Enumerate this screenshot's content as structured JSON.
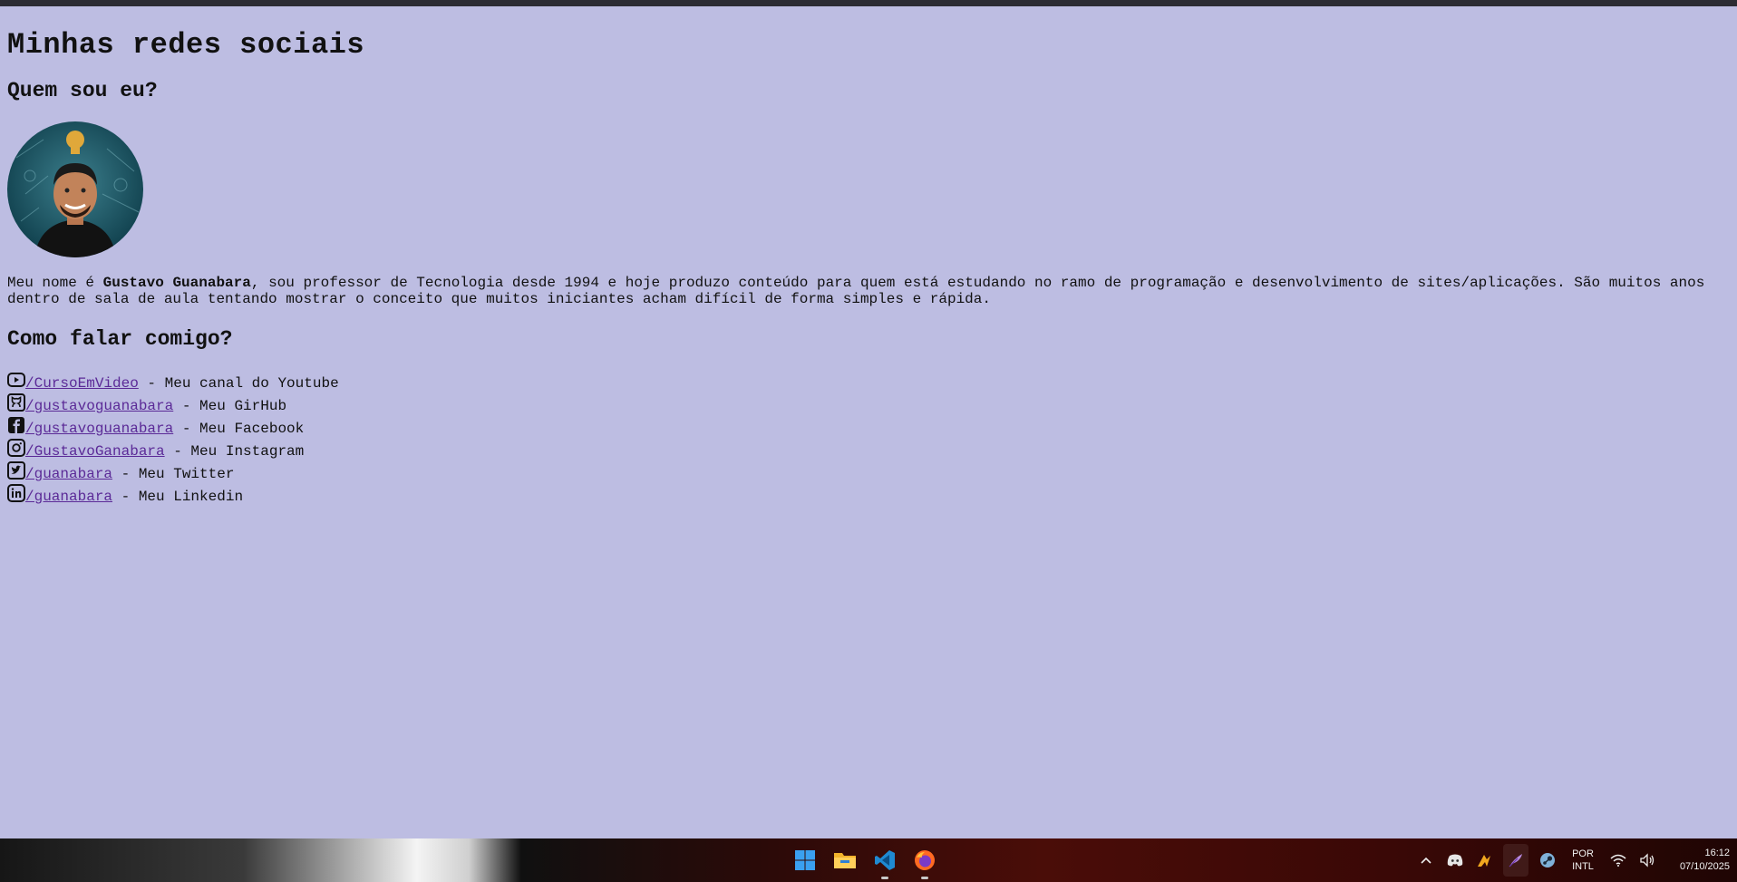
{
  "page": {
    "title": "Minhas redes sociais",
    "about_heading": "Quem sou eu?",
    "avatar_alt": "Foto de Gustavo Guanabara",
    "bio_prefix": "Meu nome é ",
    "bio_name": "Gustavo Guanabara",
    "bio_suffix": ", sou professor de Tecnologia desde 1994 e hoje produzo conteúdo para quem está estudando no ramo de programação e desenvolvimento de sites/aplicações. São muitos anos dentro de sala de aula tentando mostrar o conceito que muitos iniciantes acham difícil de forma simples e rápida.",
    "contact_heading": "Como falar comigo?"
  },
  "social": [
    {
      "icon": "youtube-icon",
      "handle": "/CursoEmVideo",
      "desc": " - Meu canal do Youtube"
    },
    {
      "icon": "github-icon",
      "handle": "/gustavoguanabara",
      "desc": " - Meu GirHub"
    },
    {
      "icon": "facebook-icon",
      "handle": "/gustavoguanabara",
      "desc": " - Meu Facebook"
    },
    {
      "icon": "instagram-icon",
      "handle": "/GustavoGanabara",
      "desc": " - Meu Instagram"
    },
    {
      "icon": "twitter-icon",
      "handle": "/guanabara",
      "desc": " - Meu Twitter"
    },
    {
      "icon": "linkedin-icon",
      "handle": "/guanabara",
      "desc": " - Meu Linkedin"
    }
  ],
  "taskbar": {
    "apps": [
      "windows-start-icon",
      "file-explorer-icon",
      "vscode-icon",
      "firefox-icon"
    ],
    "tray_icons": [
      "chevron-up-icon",
      "discord-icon",
      "app-icon",
      "feather-icon",
      "steam-icon"
    ],
    "lang_line1": "POR",
    "lang_line2": "INTL",
    "time": "16:12",
    "date": "07/10/2025"
  },
  "colors": {
    "page_bg": "#bdbde2",
    "link": "#5b2a97"
  }
}
